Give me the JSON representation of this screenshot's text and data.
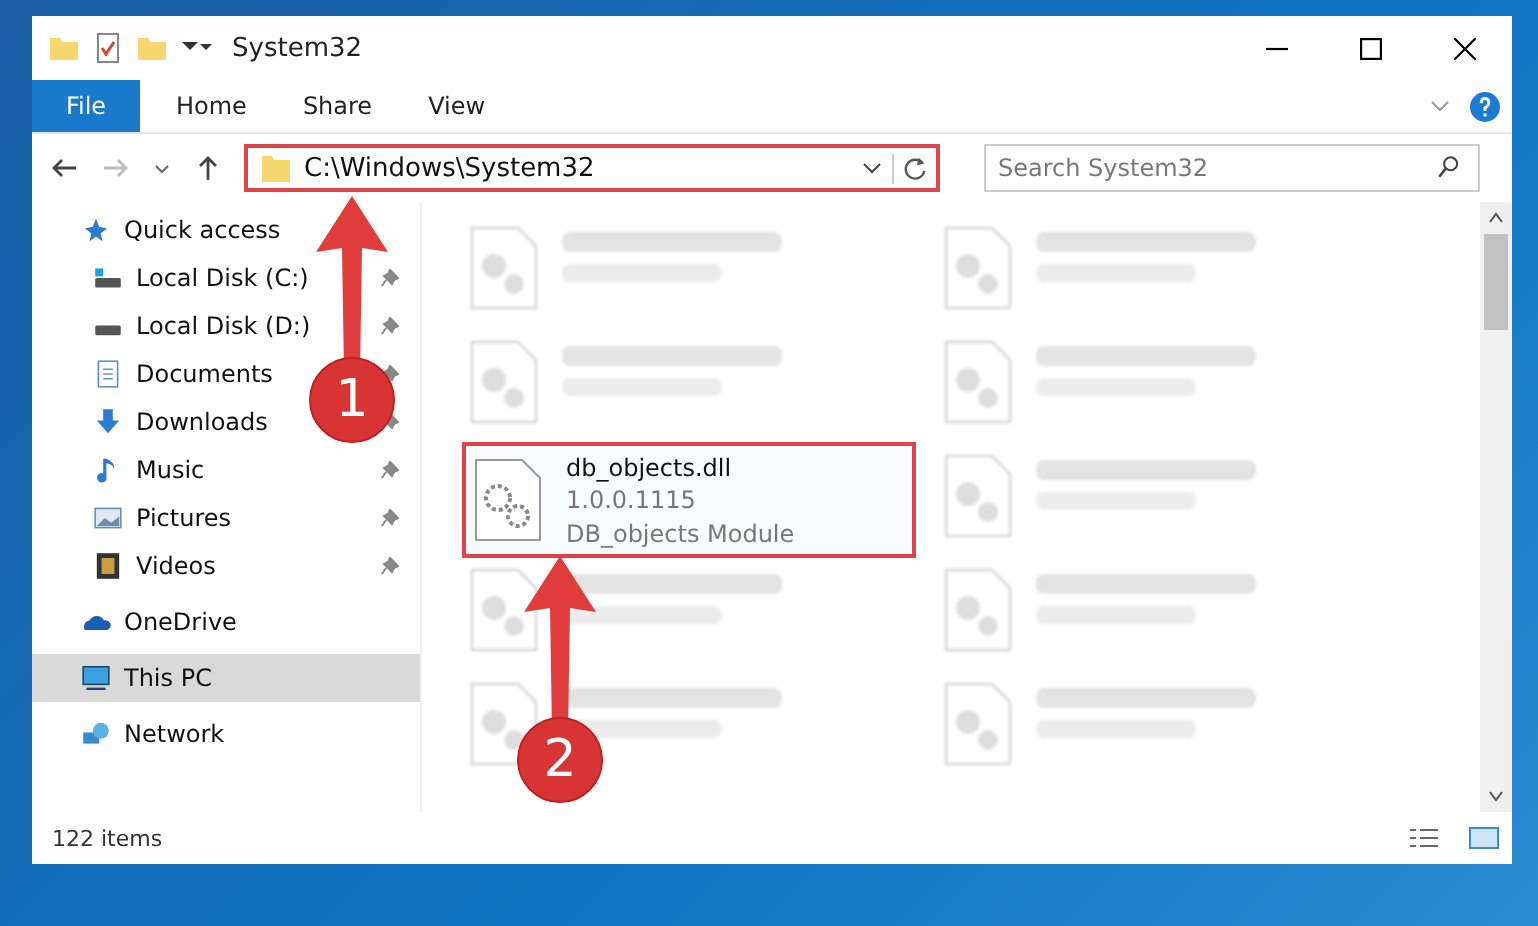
{
  "window": {
    "title": "System32"
  },
  "ribbon_tabs": [
    {
      "label": "File",
      "kind": "file"
    },
    {
      "label": "Home",
      "kind": "tab"
    },
    {
      "label": "Share",
      "kind": "tab"
    },
    {
      "label": "View",
      "kind": "tab"
    }
  ],
  "address": {
    "path": "C:\\Windows\\System32",
    "highlighted": true
  },
  "search": {
    "placeholder": "Search System32"
  },
  "sidebar": {
    "items": [
      {
        "label": "Quick access",
        "kind": "star",
        "selected": false,
        "children": [
          {
            "label": "Local Disk (C:)",
            "kind": "drive-c",
            "pinned": true,
            "selected": false
          },
          {
            "label": "Local Disk (D:)",
            "kind": "drive",
            "pinned": true,
            "selected": false
          },
          {
            "label": "Documents",
            "kind": "documents",
            "pinned": true,
            "selected": false
          },
          {
            "label": "Downloads",
            "kind": "downloads",
            "pinned": true,
            "selected": false
          },
          {
            "label": "Music",
            "kind": "music",
            "pinned": true,
            "selected": false
          },
          {
            "label": "Pictures",
            "kind": "pictures",
            "pinned": true,
            "selected": false
          },
          {
            "label": "Videos",
            "kind": "videos",
            "pinned": true,
            "selected": false
          }
        ]
      },
      {
        "label": "OneDrive",
        "kind": "cloud",
        "selected": false
      },
      {
        "label": "This PC",
        "kind": "pc",
        "selected": true
      },
      {
        "label": "Network",
        "kind": "network",
        "selected": false
      }
    ]
  },
  "files": [
    {
      "kind": "blurred"
    },
    {
      "kind": "blurred"
    },
    {
      "kind": "blurred"
    },
    {
      "kind": "blurred"
    },
    {
      "kind": "file",
      "name": "db_objects.dll",
      "lines": [
        "1.0.0.1115",
        "DB_objects Module"
      ],
      "highlighted": true
    },
    {
      "kind": "blurred"
    },
    {
      "kind": "blurred"
    },
    {
      "kind": "blurred"
    },
    {
      "kind": "blurred"
    },
    {
      "kind": "blurred"
    }
  ],
  "status_bar": {
    "item_count": "122 items"
  },
  "annotations": [
    {
      "number": "1"
    },
    {
      "number": "2"
    }
  ]
}
